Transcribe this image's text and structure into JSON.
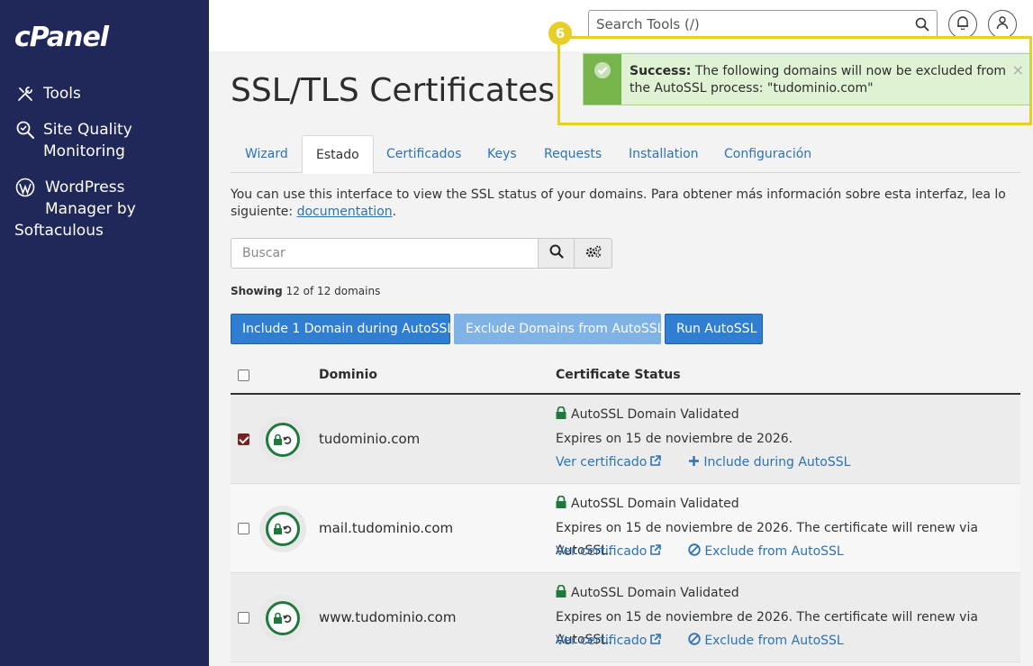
{
  "sidebar": {
    "logo": "cPanel",
    "items": [
      {
        "label": "Tools",
        "icon": "tools-icon"
      },
      {
        "label": "Site Quality Monitoring",
        "line1": "Site Quality",
        "line2": "Monitoring",
        "icon": "site-quality-icon"
      },
      {
        "label": "WordPress Manager by Softaculous",
        "line1": "WordPress",
        "line2": "Manager by",
        "line3": "Softaculous",
        "icon": "wordpress-icon"
      }
    ]
  },
  "topbar": {
    "search_placeholder": "Search Tools (/)"
  },
  "page": {
    "title": "SSL/TLS Certificates",
    "tabs": [
      "Wizard",
      "Estado",
      "Certificados",
      "Keys",
      "Requests",
      "Installation",
      "Configuración"
    ],
    "active_tab": "Estado",
    "description": "You can use this interface to view the SSL status of your domains. Para obtener más información sobre esta interfaz, lea lo siguiente:",
    "doc_link": "documentation",
    "doc_suffix": ".",
    "search_placeholder": "Buscar",
    "showing_label": "Showing",
    "showing_value": "12 of 12 domains",
    "buttons": {
      "include": "Include 1 Domain during AutoSSL",
      "exclude": "Exclude Domains from AutoSSL",
      "run": "Run AutoSSL"
    },
    "table": {
      "col_domain": "Dominio",
      "col_status": "Certificate Status",
      "rows": [
        {
          "checked": true,
          "domain": "tudominio.com",
          "status": "AutoSSL Domain Validated",
          "expires": "Expires on 15 de noviembre de 2026.",
          "view_link": "Ver certificado",
          "action_link": "Include during AutoSSL",
          "action_icon": "plus-icon"
        },
        {
          "checked": false,
          "domain": "mail.tudominio.com",
          "status": "AutoSSL Domain Validated",
          "expires": "Expires on 15 de noviembre de 2026. The certificate will renew via AutoSSL.",
          "view_link": "Ver certificado",
          "action_link": "Exclude from AutoSSL",
          "action_icon": "ban-icon"
        },
        {
          "checked": false,
          "domain": "www.tudominio.com",
          "status": "AutoSSL Domain Validated",
          "expires": "Expires on 15 de noviembre de 2026. The certificate will renew via AutoSSL.",
          "view_link": "Ver certificado",
          "action_link": "Exclude from AutoSSL",
          "action_icon": "ban-icon"
        }
      ]
    }
  },
  "notification": {
    "step": "6",
    "title": "Success:",
    "message": "The following domains will now be excluded from the AutoSSL process: \"tudominio.com\"",
    "close": "×"
  },
  "colors": {
    "sidebar_bg": "#20285a",
    "link": "#2b73b3",
    "primary_button": "#2f7ed2",
    "success_bg": "#dff2d3",
    "success_accent": "#78b44c",
    "highlight": "#e8cf28",
    "lock_green": "#1e7a3c"
  }
}
